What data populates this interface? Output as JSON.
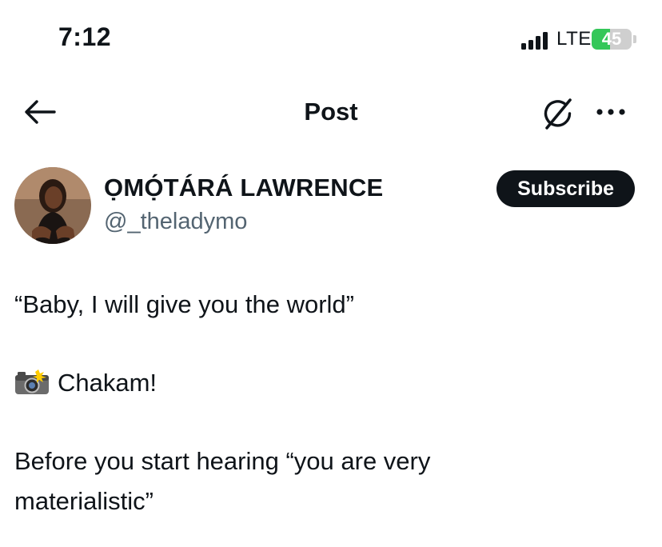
{
  "status_bar": {
    "time": "7:12",
    "network": "LTE",
    "battery_percent": "45",
    "battery_level": 0.45,
    "battery_color": "#34c759",
    "icons": [
      "signal-icon",
      "battery-icon"
    ]
  },
  "nav": {
    "title": "Post",
    "icons": [
      "back-arrow-icon",
      "grok-icon",
      "more-icon"
    ]
  },
  "author": {
    "display_name": "ỌMỌ́TÁRÁ LAWRENCE",
    "handle": "@_theladymo",
    "subscribe_label": "Subscribe"
  },
  "post": {
    "line1": "“Baby, I will give you the world”",
    "line2_icon": "camera-flash-icon",
    "line2": "Chakam!",
    "line3": "Before you start hearing “you are very materialistic”"
  },
  "colors": {
    "text": "#0f1419",
    "secondary_text": "#536471",
    "subscribe_bg": "#0f1419"
  }
}
